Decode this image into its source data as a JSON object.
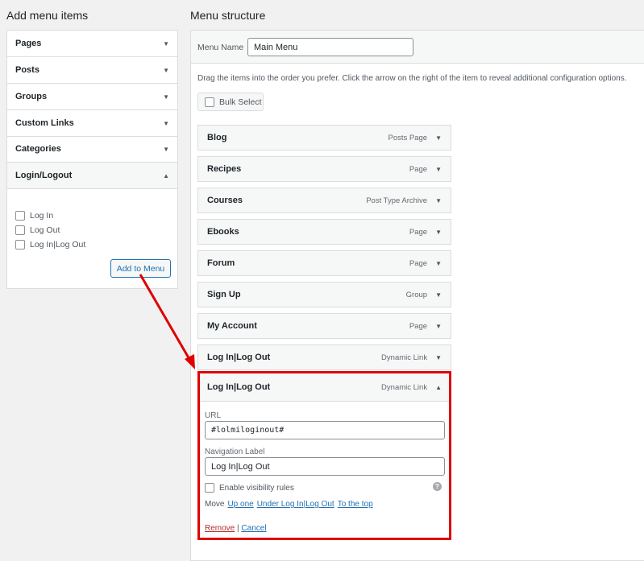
{
  "left": {
    "title": "Add menu items",
    "sections": [
      {
        "label": "Pages"
      },
      {
        "label": "Posts"
      },
      {
        "label": "Groups"
      },
      {
        "label": "Custom Links"
      },
      {
        "label": "Categories"
      },
      {
        "label": "Login/Logout"
      }
    ],
    "options": [
      {
        "label": "Log In"
      },
      {
        "label": "Log Out"
      },
      {
        "label": "Log In|Log Out"
      }
    ],
    "add_button": "Add to Menu"
  },
  "right": {
    "title": "Menu structure",
    "menu_name_label": "Menu Name",
    "menu_name_value": "Main Menu",
    "instructions": "Drag the items into the order you prefer. Click the arrow on the right of the item to reveal additional configuration options.",
    "bulk_select": "Bulk Select",
    "items": [
      {
        "title": "Blog",
        "type": "Posts Page"
      },
      {
        "title": "Recipes",
        "type": "Page"
      },
      {
        "title": "Courses",
        "type": "Post Type Archive"
      },
      {
        "title": "Ebooks",
        "type": "Page"
      },
      {
        "title": "Forum",
        "type": "Page"
      },
      {
        "title": "Sign Up",
        "type": "Group"
      },
      {
        "title": "My Account",
        "type": "Page"
      },
      {
        "title": "Log In|Log Out",
        "type": "Dynamic Link"
      }
    ],
    "expanded": {
      "title": "Log In|Log Out",
      "type": "Dynamic Link",
      "url_label": "URL",
      "url_value": "#lolmiloginout#",
      "nav_label": "Navigation Label",
      "nav_value": "Log In|Log Out",
      "visibility": "Enable visibility rules",
      "move": "Move",
      "up_one": "Up one",
      "under": "Under Log In|Log Out",
      "to_top": "To the top",
      "remove": "Remove",
      "sep": "|",
      "cancel": "Cancel"
    }
  },
  "colors": {
    "highlight": "#e00000",
    "link": "#2271b1",
    "remove": "#b32d2e"
  }
}
